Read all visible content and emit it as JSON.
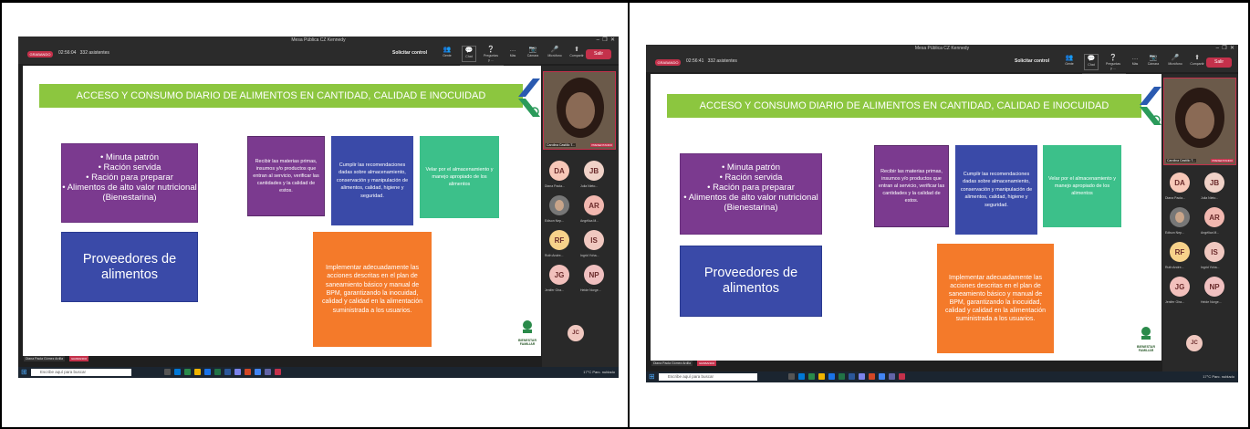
{
  "app": {
    "window_title": "Mesa Pública CZ Kennedy",
    "recording_badge": "GRABANDO",
    "join_control": "Solicitar control",
    "toolbar_buttons": [
      "Gente",
      "Chat",
      "Preguntas y ...",
      "Más"
    ],
    "media_buttons": [
      "Cámara",
      "Micrófono",
      "Compartir"
    ],
    "leave_label": "Salir",
    "tooltip": "Mostrar conversación",
    "taskbar_search": "Escribe aquí para buscar",
    "weather": "17°C Parc. nublado"
  },
  "slide": {
    "banner_title": "ACCESO Y CONSUMO DIARIO DE ALIMENTOS EN CANTIDAD, CALIDAD E INOCUIDAD",
    "list_items": [
      "• Minuta patrón",
      "• Ración servida",
      "• Ración para preparar",
      "• Alimentos de alto valor nutricional (Bienestarina)"
    ],
    "providers": "Proveedores de alimentos",
    "box_receive": "Recibir las materias primas, insumos y/o productos que entran al servicio, verificar las cantidades y la calidad de estos.",
    "box_comply": "Cumplir las recomendaciones dadas sobre almacenamiento, conservación y manipulación de alimentos, calidad, higiene y seguridad.",
    "box_storage": "Velar por el almacenamiento y manejo apropiado de los alimentos",
    "box_implement": "Implementar adecuadamente las acciones descritas en el plan de saneamiento básico y manual de BPM, garantizando la inocuidad, calidad y calidad en la alimentación suministrada a los usuarios.",
    "logo_text": "BIENESTAR FAMILIAR"
  },
  "presenter": {
    "name": "Diana Paola Gómez Ardila",
    "badge": "GRABANDO"
  },
  "sidebar": {
    "video_name": "Carolina Castillo T...",
    "video_badge": "PRESENTANDO",
    "participants": [
      {
        "initials": "DA",
        "name": "Diana Paola...",
        "color": "#f7c8b8"
      },
      {
        "initials": "JB",
        "name": "Julia Nieto...",
        "color": "#f0d2c8"
      },
      {
        "initials": "",
        "name": "Edison Nep...",
        "color": "#777777"
      },
      {
        "initials": "AR",
        "name": "Angélica M...",
        "color": "#f2b8b0"
      },
      {
        "initials": "RF",
        "name": "Ruth Andre...",
        "color": "#f7d28a"
      },
      {
        "initials": "IS",
        "name": "Ingrid Yoha...",
        "color": "#f0c8c0"
      },
      {
        "initials": "JG",
        "name": "Jenifer Gira...",
        "color": "#f2c0bc"
      },
      {
        "initials": "NP",
        "name": "Heide Norge...",
        "color": "#f0c0c0"
      },
      {
        "initials": "JC",
        "name": "",
        "color": "#f0c8c0"
      }
    ]
  },
  "left": {
    "timer": "02:56:04",
    "attendees": "332 asistentes"
  },
  "right": {
    "timer": "02:56:41",
    "attendees": "332 asistentes"
  }
}
